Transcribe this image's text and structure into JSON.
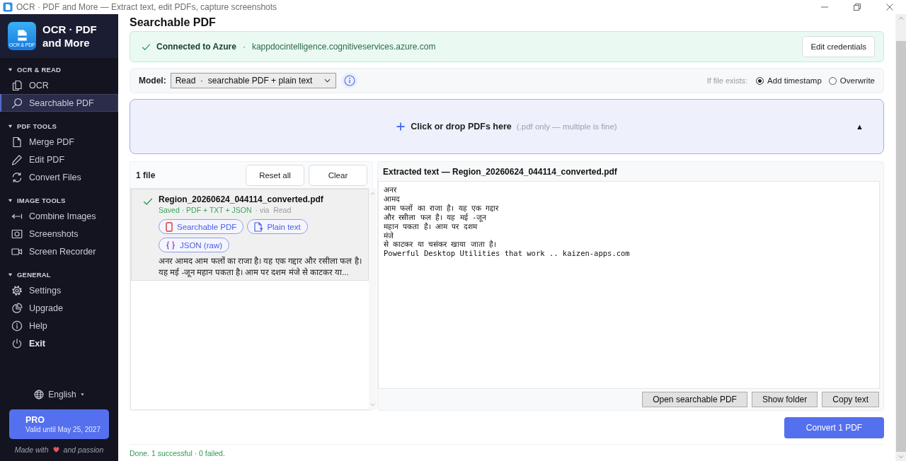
{
  "window": {
    "title": "OCR · PDF and More — Extract text, edit PDFs, capture screenshots"
  },
  "sidebar": {
    "app_name": "OCR · PDF and More",
    "logo_caption": "OCR & PDF",
    "sections": [
      {
        "title": "OCR & READ",
        "expanded": true,
        "items": [
          {
            "label": "OCR",
            "kind": "nav",
            "selected": false
          },
          {
            "label": "Searchable PDF",
            "kind": "nav",
            "selected": true
          }
        ]
      },
      {
        "title": "PDF TOOLS",
        "expanded": true,
        "items": [
          {
            "label": "Merge PDF",
            "kind": "nav",
            "selected": false
          },
          {
            "label": "Edit PDF",
            "kind": "nav",
            "selected": false
          },
          {
            "label": "Convert Files",
            "kind": "nav",
            "selected": false
          }
        ]
      },
      {
        "title": "IMAGE TOOLS",
        "expanded": true,
        "items": [
          {
            "label": "Combine Images",
            "kind": "nav",
            "selected": false
          },
          {
            "label": "Screenshots",
            "kind": "nav",
            "selected": false
          },
          {
            "label": "Screen Recorder",
            "kind": "nav",
            "selected": false
          }
        ]
      },
      {
        "title": "GENERAL",
        "expanded": true,
        "items": [
          {
            "label": "Settings",
            "kind": "nav",
            "selected": false
          },
          {
            "label": "Upgrade",
            "kind": "nav",
            "selected": false
          },
          {
            "label": "Help",
            "kind": "nav",
            "selected": false
          },
          {
            "label": "Exit",
            "kind": "exit",
            "selected": false
          }
        ]
      }
    ],
    "language": "English",
    "pro": {
      "title": "PRO",
      "subtitle": "Valid until May 25, 2027"
    },
    "footer": {
      "before": "Made with",
      "after": "and passion"
    }
  },
  "page": {
    "title": "Searchable PDF"
  },
  "connection": {
    "connected": true,
    "status": "Connected to Azure",
    "separator": "·",
    "endpoint": "kappdocintelligence.cognitiveservices.azure.com",
    "button": "Edit credentials"
  },
  "model_bar": {
    "label": "Model:",
    "model": "Read  ·  searchable PDF + plain text",
    "exists_label": "If file exists:",
    "options": [
      {
        "label": "Add timestamp",
        "selected": true
      },
      {
        "label": "Overwrite",
        "selected": false
      }
    ]
  },
  "drop_zone": {
    "label": "Click or drop PDFs here",
    "hint": "(.pdf only — multiple is fine)",
    "toggle": "▲"
  },
  "file_list": {
    "count": "1 file",
    "buttons": [
      "Reset all",
      "Clear"
    ],
    "files": [
      {
        "name": "Region_20260624_044114_converted.pdf",
        "done": true,
        "selected": true,
        "saved": "Saved · PDF + TXT + JSON",
        "via": "· via  Read",
        "outputs": [
          {
            "kind": "pdf",
            "label": "Searchable PDF"
          },
          {
            "kind": "text",
            "label": "Plain text"
          },
          {
            "kind": "json",
            "label": "JSON (raw)"
          }
        ],
        "preview": "अनर आमद आम फलों का राजा है। यह एक गद्दार और रसीला फल है। यह मई -जून महान पकता है। आम पर दशम मंजे से काटकर या..."
      }
    ]
  },
  "extracted": {
    "title": "Extracted text — Region_20260624_044114_converted.pdf",
    "lines": [
      "अनर",
      "आमद",
      "आम फलों का राजा है। यह एक गद्दार",
      "और रसीला फल है। यह मई -जून",
      "महान पकता है। आम पर दशम",
      "मंजे",
      "से काटकर या चसंकर खाया जाता है।",
      "Powerful Desktop Utilities that work .. kaizen-apps.com"
    ],
    "buttons": [
      "Open searchable PDF",
      "Show folder",
      "Copy text"
    ]
  },
  "convert_button": "Convert 1 PDF",
  "status_bar": "Done. 1 successful · 0 failed."
}
